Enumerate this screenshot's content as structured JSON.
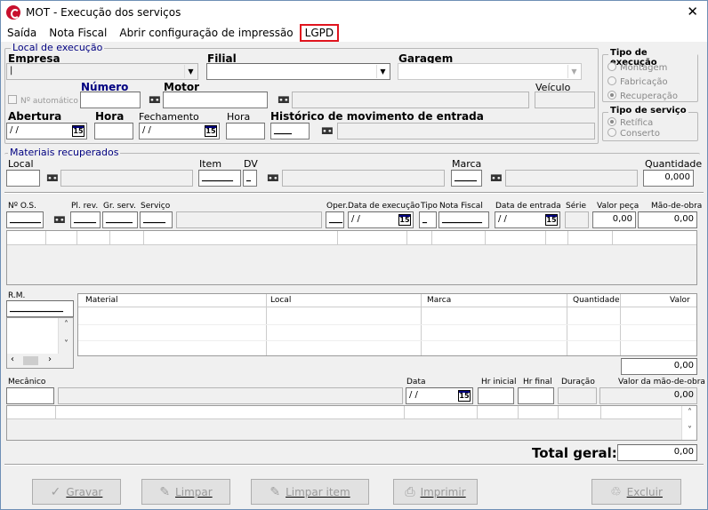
{
  "window": {
    "title": "MOT - Execução dos serviços",
    "close": "✕"
  },
  "menu": [
    "Saída",
    "Nota Fiscal",
    "Abrir configuração de impressão",
    "LGPD"
  ],
  "local_execucao": {
    "title": "Local de execução",
    "empresa": "Empresa",
    "filial": "Filial",
    "garagem": "Garagem",
    "n_automatico": "Nº automático",
    "numero": "Número",
    "motor": "Motor",
    "veiculo": "Veículo",
    "abertura": "Abertura",
    "abertura_value": "/ /",
    "hora": "Hora",
    "fechamento": "Fechamento",
    "fechamento_value": "/ /",
    "hora2": "Hora",
    "historico": "Histórico de movimento de entrada"
  },
  "tipo_execucao": {
    "title": "Tipo de execução",
    "options": [
      "Montagem",
      "Fabricação",
      "Recuperação"
    ],
    "selected": "Recuperação"
  },
  "tipo_servico": {
    "title": "Tipo de serviço",
    "options": [
      "Retífica",
      "Conserto"
    ],
    "selected": "Retífica"
  },
  "materiais": {
    "title": "Materiais recuperados",
    "local": "Local",
    "item": "Item",
    "dv": "DV",
    "marca": "Marca",
    "quantidade": "Quantidade",
    "quantidade_value": "0,000"
  },
  "os": {
    "nos": "Nº O.S.",
    "pl_rev": "Pl. rev.",
    "gr_serv": "Gr. serv.",
    "servico": "Serviço",
    "oper": "Oper.",
    "data_execucao": "Data de execução",
    "data_execucao_value": "/ /",
    "tipo": "Tipo",
    "nota_fiscal": "Nota Fiscal",
    "data_entrada": "Data de entrada",
    "data_entrada_value": "/ /",
    "serie": "Série",
    "valor_peca": "Valor peça",
    "valor_peca_value": "0,00",
    "mao_obra": "Mão-de-obra",
    "mao_obra_value": "0,00"
  },
  "rm": {
    "label": "R.M.",
    "columns": [
      "Material",
      "Local",
      "Marca",
      "Quantidade",
      "Valor"
    ],
    "total": "0,00"
  },
  "mecanico": {
    "label": "Mecânico",
    "data": "Data",
    "data_value": "/ /",
    "hr_inicial": "Hr inicial",
    "hr_final": "Hr final",
    "duracao": "Duração",
    "valor_mao": "Valor da mão-de-obra",
    "valor_mao_value": "0,00"
  },
  "total": {
    "label": "Total geral:",
    "value": "0,00"
  },
  "buttons": {
    "gravar": "Gravar",
    "limpar": "Limpar",
    "limpar_item": "Limpar item",
    "imprimir": "Imprimir",
    "excluir": "Excluir"
  }
}
